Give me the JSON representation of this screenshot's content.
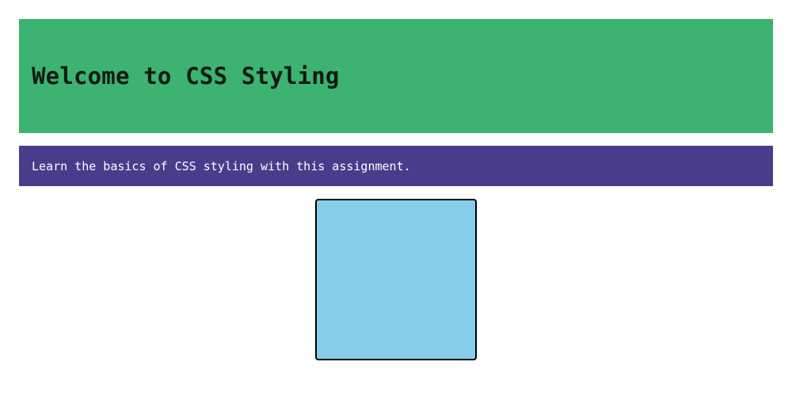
{
  "header": {
    "title": "Welcome to CSS Styling",
    "background_color": "#3cb371"
  },
  "banner": {
    "text": "Learn the basics of CSS styling with this assignment.",
    "background_color": "#483d8b"
  },
  "box": {
    "background_color": "#87ceeb"
  }
}
